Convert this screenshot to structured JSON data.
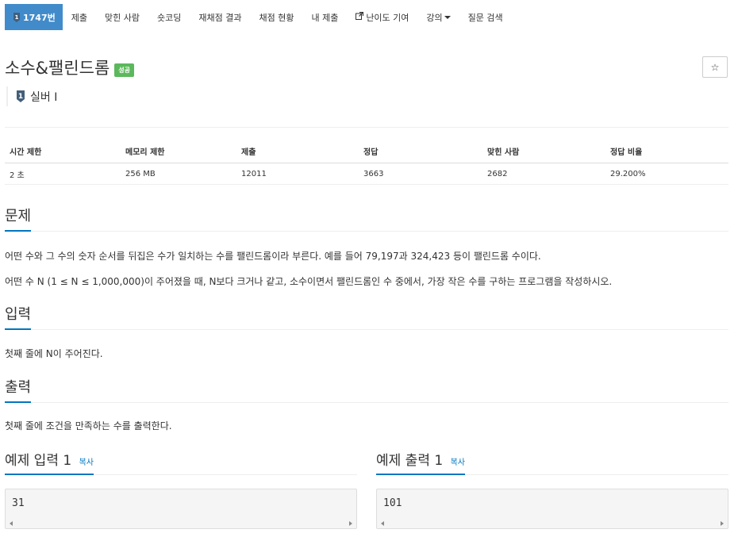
{
  "nav": {
    "problem_tab": "1747번",
    "items": [
      "제출",
      "맞힌 사람",
      "숏코딩",
      "재채점 결과",
      "채점 현황",
      "내 제출",
      "난이도 기여",
      "강의",
      "질문 검색"
    ]
  },
  "problem": {
    "title": "소수&팰린드롬",
    "result_badge": "성공",
    "tier": "실버 I",
    "star_icon": "☆"
  },
  "stats": {
    "headers": [
      "시간 제한",
      "메모리 제한",
      "제출",
      "정답",
      "맞힌 사람",
      "정답 비율"
    ],
    "values": [
      "2 초",
      "256 MB",
      "12011",
      "3663",
      "2682",
      "29.200%"
    ]
  },
  "sections": {
    "description": {
      "title": "문제",
      "paragraphs": [
        "어떤 수와 그 수의 숫자 순서를 뒤집은 수가 일치하는 수를 팰린드롬이라 부른다. 예를 들어 79,197과 324,423 등이 팰린드롬 수이다.",
        "어떤 수 N (1 ≤ N ≤ 1,000,000)이 주어졌을 때, N보다 크거나 같고, 소수이면서 팰린드롬인 수 중에서, 가장 작은 수를 구하는 프로그램을 작성하시오."
      ]
    },
    "input": {
      "title": "입력",
      "text": "첫째 줄에 N이 주어진다."
    },
    "output": {
      "title": "출력",
      "text": "첫째 줄에 조건을 만족하는 수를 출력한다."
    }
  },
  "samples": {
    "input": {
      "title": "예제 입력 1",
      "copy": "복사",
      "value": "31"
    },
    "output": {
      "title": "예제 출력 1",
      "copy": "복사",
      "value": "101"
    }
  },
  "colors": {
    "accent": "#428bca",
    "success": "#5cb85c",
    "link": "#0076c0",
    "tier": "#435f7a"
  }
}
